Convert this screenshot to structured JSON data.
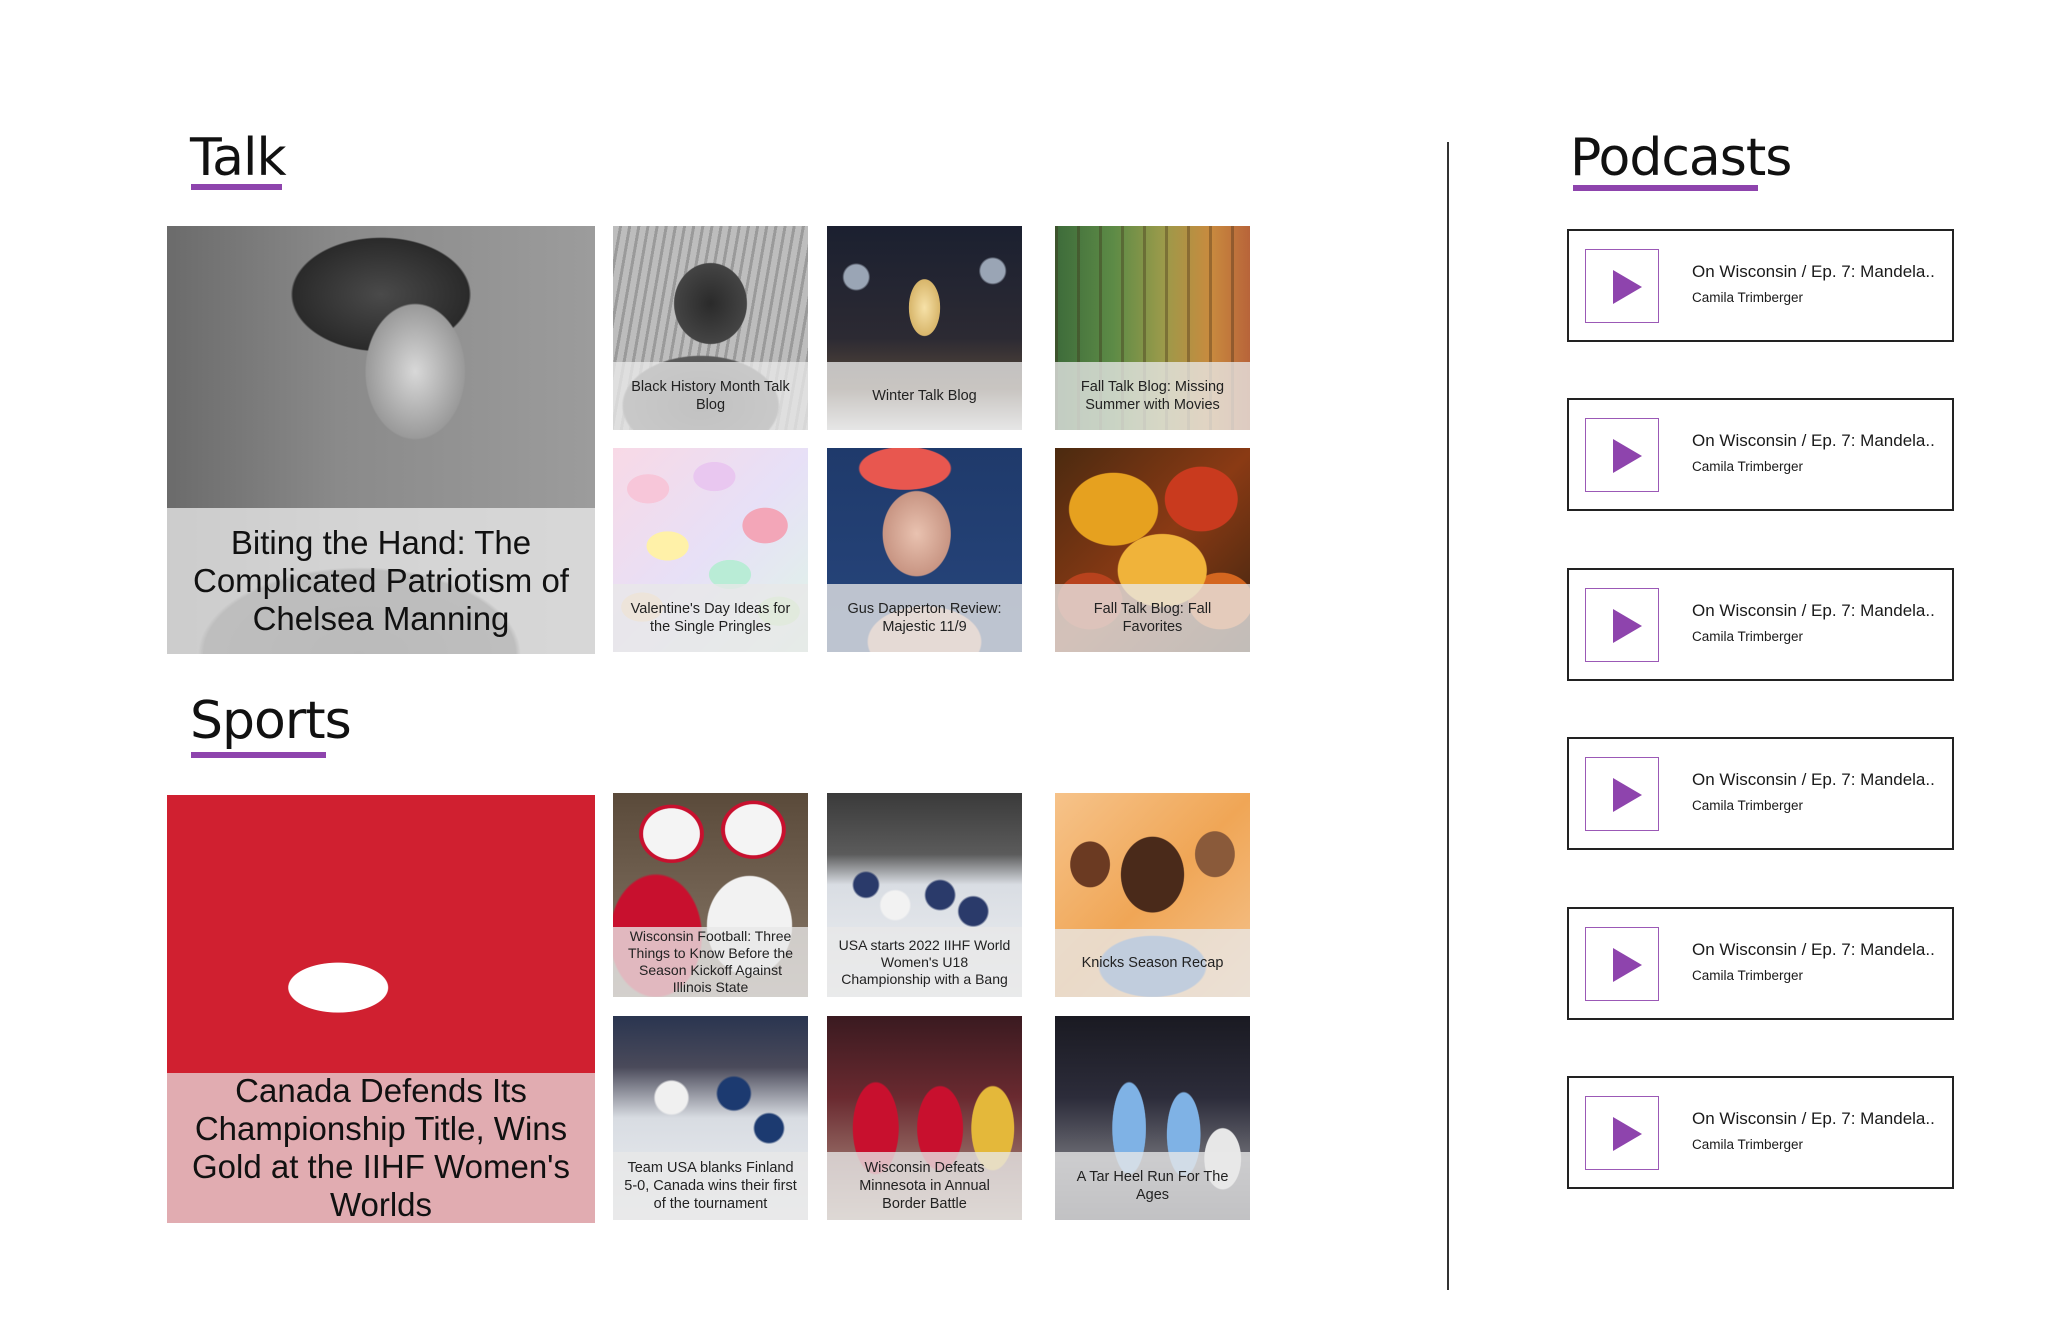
{
  "talk": {
    "title": "Talk",
    "featured": {
      "caption": "Biting the Hand: The Complicated Patriotism of Chelsea Manning"
    },
    "cards": [
      {
        "caption": "Black History Month Talk Blog"
      },
      {
        "caption": "Winter Talk Blog"
      },
      {
        "caption": "Fall Talk Blog: Missing Summer with Movies"
      },
      {
        "caption": "Valentine's Day Ideas for the Single Pringles"
      },
      {
        "caption": "Gus Dapperton Review: Majestic 11/9"
      },
      {
        "caption": "Fall Talk Blog: Fall Favorites"
      }
    ]
  },
  "sports": {
    "title": "Sports",
    "featured": {
      "caption": "Canada Defends Its Championship Title, Wins Gold at the IIHF Women's Worlds"
    },
    "cards": [
      {
        "caption": "Wisconsin Football: Three Things to Know Before the Season Kickoff Against Illinois State"
      },
      {
        "caption": "USA starts 2022 IIHF World Women's U18 Championship with a Bang"
      },
      {
        "caption": "Knicks Season Recap"
      },
      {
        "caption": "Team USA blanks Finland 5-0, Canada wins their first of the tournament"
      },
      {
        "caption": "Wisconsin Defeats Minnesota in Annual Border Battle"
      },
      {
        "caption": "A Tar Heel Run For The Ages"
      }
    ]
  },
  "podcasts": {
    "title": "Podcasts",
    "play_icon": "play-icon",
    "accent_color": "#8e44ad",
    "items": [
      {
        "title": "On Wisconsin / Ep. 7: Mandela..",
        "author": "Camila Trimberger"
      },
      {
        "title": "On Wisconsin / Ep. 7: Mandela..",
        "author": "Camila Trimberger"
      },
      {
        "title": "On Wisconsin / Ep. 7: Mandela..",
        "author": "Camila Trimberger"
      },
      {
        "title": "On Wisconsin / Ep. 7: Mandela..",
        "author": "Camila Trimberger"
      },
      {
        "title": "On Wisconsin / Ep. 7: Mandela..",
        "author": "Camila Trimberger"
      },
      {
        "title": "On Wisconsin / Ep. 7: Mandela..",
        "author": "Camila Trimberger"
      }
    ]
  }
}
